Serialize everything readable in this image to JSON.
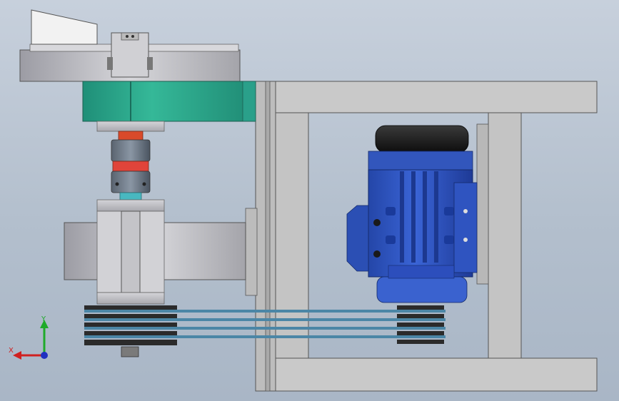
{
  "viewport": {
    "view": "front",
    "background_top": "#c7d0dc",
    "background_bottom": "#a9b6c6"
  },
  "model": {
    "frame_color": "#c6c6c6",
    "motor_color": "#2f56c4",
    "motor_cap_color": "#151515",
    "housing_color": "#2aa58a",
    "coupling_color": "#d94a2a",
    "belt_color": "#4b86a6",
    "pulley_color": "#2b2b2b"
  },
  "triad": {
    "x_label": "X",
    "y_label": "Y",
    "x_color": "#d02020",
    "y_color": "#1faa2a",
    "z_color": "#2030c0",
    "icon": "coordinate-triad-icon"
  }
}
